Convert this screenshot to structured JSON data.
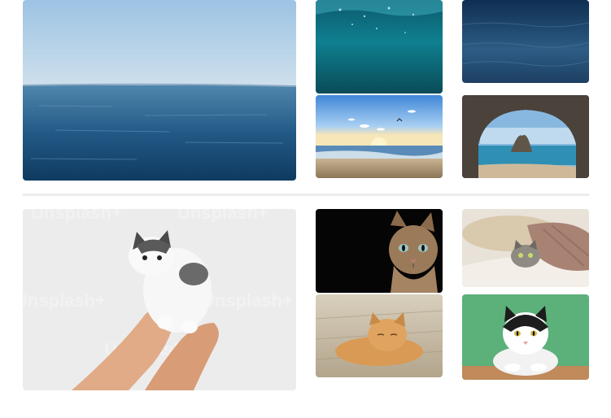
{
  "gallery": {
    "sections": [
      {
        "topic": "sea",
        "tiles": [
          {
            "subject": "calm-sea-horizon"
          },
          {
            "subject": "underwater-surface"
          },
          {
            "subject": "dark-sea-water"
          },
          {
            "subject": "beach-sunset-birds"
          },
          {
            "subject": "sea-cave-arch"
          }
        ]
      },
      {
        "topic": "cats",
        "tiles": [
          {
            "subject": "kitten-in-hands",
            "watermark": "Unsplash+"
          },
          {
            "subject": "tabby-cat-dark"
          },
          {
            "subject": "cat-under-blanket"
          },
          {
            "subject": "orange-cat-floor"
          },
          {
            "subject": "black-white-cat-green"
          }
        ]
      }
    ]
  },
  "colors": {
    "divider": "#ececec",
    "background": "#ffffff"
  }
}
